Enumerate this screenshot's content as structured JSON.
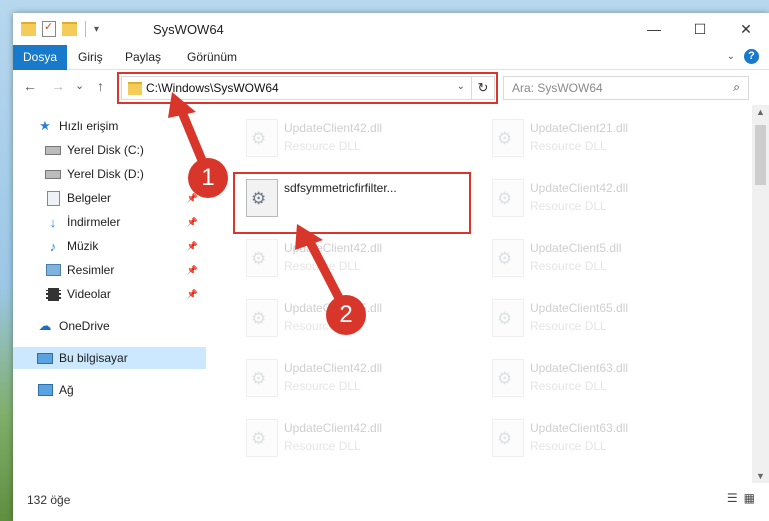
{
  "window": {
    "title": "SysWOW64"
  },
  "title_buttons": {
    "minimize": "—",
    "maximize": "☐",
    "close": "✕"
  },
  "ribbon": {
    "tabs": [
      "Dosya",
      "Giriş",
      "Paylaş",
      "Görünüm"
    ],
    "help": "?"
  },
  "nav": {
    "back": "←",
    "forward": "→",
    "recent": "⌄",
    "up": "↑",
    "path": "C:\\Windows\\SysWOW64",
    "refresh": "↻",
    "search_placeholder": "Ara: SysWOW64"
  },
  "sidebar": {
    "items": [
      {
        "label": "Hızlı erişim",
        "icon": "star-icon"
      },
      {
        "label": "Yerel Disk (C:)",
        "icon": "drive-icon"
      },
      {
        "label": "Yerel Disk (D:)",
        "icon": "drive-icon"
      },
      {
        "label": "Belgeler",
        "icon": "documents-icon",
        "pinned": true
      },
      {
        "label": "İndirmeler",
        "icon": "download-icon",
        "pinned": true
      },
      {
        "label": "Müzik",
        "icon": "music-icon",
        "pinned": true
      },
      {
        "label": "Resimler",
        "icon": "pictures-icon",
        "pinned": true
      },
      {
        "label": "Videolar",
        "icon": "videos-icon",
        "pinned": true
      },
      {
        "label": "OneDrive",
        "icon": "cloud-icon"
      },
      {
        "label": "Bu bilgisayar",
        "icon": "computer-icon",
        "selected": true
      },
      {
        "label": "Ağ",
        "icon": "network-icon"
      }
    ]
  },
  "files": {
    "highlighted": {
      "name": "sdfsymmetricfirfilter..."
    },
    "items": [
      {
        "name": "UpdateClient42.dll",
        "type": "Resource DLL"
      },
      {
        "name": "UpdateClient21.dll",
        "type": "Resource DLL"
      },
      {
        "name": "UpdateClient42.dll",
        "type": "Resource DLL"
      },
      {
        "name": "UpdateClient42.dll",
        "type": "Resource DLL"
      },
      {
        "name": "UpdateClient5.dll",
        "type": "Resource DLL"
      },
      {
        "name": "UpdateClient65.dll",
        "type": "Resource DLL"
      },
      {
        "name": "UpdateClient65.dll",
        "type": "Resource DLL"
      },
      {
        "name": "UpdateClient42.dll",
        "type": "Resource DLL"
      },
      {
        "name": "UpdateClient63.dll",
        "type": "Resource DLL"
      },
      {
        "name": "UpdateClient42.dll",
        "type": "Resource DLL"
      },
      {
        "name": "UpdateClient63.dll",
        "type": "Resource DLL"
      }
    ]
  },
  "status": {
    "count": "132 öğe"
  },
  "annotations": {
    "step1": "1",
    "step2": "2"
  },
  "colors": {
    "accent": "#1979ca",
    "highlight": "#d9362b",
    "selected": "#cce8ff"
  }
}
